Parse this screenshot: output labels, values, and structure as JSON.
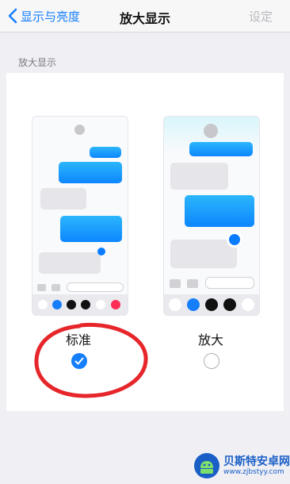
{
  "navbar": {
    "back_label": "显示与亮度",
    "title": "放大显示",
    "action_label": "设定"
  },
  "section": {
    "header": "放大显示"
  },
  "options": [
    {
      "label": "标准",
      "selected": true
    },
    {
      "label": "放大",
      "selected": false
    }
  ],
  "watermark": {
    "title": "贝斯特安卓网",
    "url": "www.zjbstyy.com"
  },
  "colors": {
    "accent": "#157efb",
    "annotation_red": "#e6262a",
    "bubble_blue": "#1a9bfc",
    "bubble_grey": "#e5e5ea"
  }
}
